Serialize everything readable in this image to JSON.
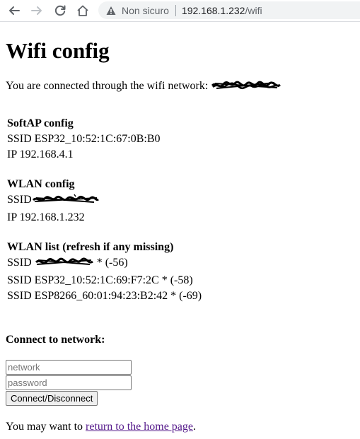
{
  "browser": {
    "security_label": "Non sicuro",
    "url_host": "192.168.1.232",
    "url_path": "/wifi"
  },
  "page": {
    "title": "Wifi config",
    "intro": "You are connected through the wifi network:",
    "softap": {
      "title": "SoftAP config",
      "ssid_line": "SSID ESP32_10:52:1C:67:0B:B0",
      "ip_line": "IP 192.168.4.1"
    },
    "wlan": {
      "title": "WLAN config",
      "ssid_prefix": "SSID",
      "ip_line": "IP 192.168.1.232"
    },
    "wlan_list": {
      "title": "WLAN list (refresh if any missing)",
      "items": [
        {
          "prefix": "SSID",
          "suffix": " * (-56)"
        },
        {
          "text": "SSID ESP32_10:52:1C:69:F7:2C * (-58)"
        },
        {
          "text": "SSID ESP8266_60:01:94:23:B2:42 * (-69)"
        }
      ]
    },
    "connect": {
      "title": "Connect to network:",
      "network_placeholder": "network",
      "password_placeholder": "password",
      "button_label": "Connect/Disconnect"
    },
    "footer": {
      "prefix": "You may want to",
      "link_text": "return to the home page",
      "suffix": "."
    }
  }
}
